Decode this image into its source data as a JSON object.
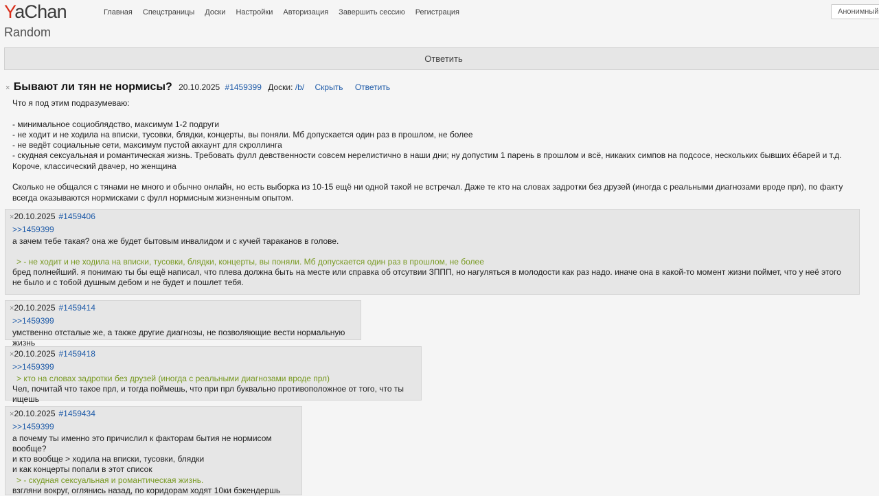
{
  "header": {
    "logo_y": "Y",
    "logo_rest": "aChan",
    "nav": [
      "Главная",
      "Спецстраницы",
      "Доски",
      "Настройки",
      "Авторизация",
      "Завершить сессию",
      "Регистрация"
    ],
    "user_label": "Анонимный"
  },
  "board": {
    "title": "Random",
    "reply_label": "Ответить"
  },
  "op": {
    "close": "×",
    "title": "Бывают ли тян не нормисы?",
    "date": "20.10.2025",
    "number": "#1459399",
    "boards_label": "Доски:",
    "board_link": "/b/",
    "hide_label": "Скрыть",
    "reply_label": "Ответить",
    "body": [
      "Что я под этим подразумеваю:",
      "",
      "- минимальное социоблядство, максимум 1-2 подруги",
      "- не ходит и не ходила на вписки, тусовки, блядки, концерты, вы поняли. Мб допускается один раз в прошлом, не более",
      "- не ведёт социальные сети, максимум пустой аккаунт для скроллинга",
      "- скудная сексуальная и романтическая жизнь. Требовать фулл девственности совсем нерелистично в наши дни; ну допустим 1 парень в прошлом и всё, никаких симпов на подсосе, нескольких бывших ёбарей и т.д.",
      "Короче, классический двачер, но женщина",
      "",
      "Сколько не общался с тянами не много и обычно онлайн, но есть выборка из 10-15 ещё ни одной такой не встречал. Даже те кто на словах задротки без друзей (иногда с реальными диагнозами вроде прл), по факту всегда оказываются нормисками с фулл нормисным жизненным опытом."
    ]
  },
  "replies": [
    {
      "date": "20.10.2025",
      "number": "#1459406",
      "reflink": ">>1459399",
      "lines": [
        {
          "t": "text",
          "v": "а зачем тебе такая? она же будет бытовым инвалидом и с кучей тараканов в голове."
        },
        {
          "t": "gap"
        },
        {
          "t": "quote",
          "v": "> - не ходит и не ходила на вписки, тусовки, блядки, концерты, вы поняли. Мб допускается один раз в прошлом, не более"
        },
        {
          "t": "text",
          "v": "бред полнейший. я понимаю ты бы ещё написал, что плева должна быть на месте или справка об отсутвии ЗППП, но нагуляться в молодости как раз надо. иначе она в какой-то момент жизни поймет, что у неё этого не было и с тобой душным дебом и не будет и пошлет тебя."
        }
      ]
    },
    {
      "date": "20.10.2025",
      "number": "#1459414",
      "reflink": ">>1459399",
      "lines": [
        {
          "t": "text",
          "v": "умственно отсталые же, а также другие диагнозы, не позволяющие вести нормальную жизнь"
        }
      ]
    },
    {
      "date": "20.10.2025",
      "number": "#1459418",
      "reflink": ">>1459399",
      "lines": [
        {
          "t": "quote",
          "v": "> кто на словах задротки без друзей (иногда с реальными диагнозами вроде прл)"
        },
        {
          "t": "text",
          "v": "Чел, почитай что такое прл, и тогда поймешь, что при прл буквально противоположное от того, что ты ищешь"
        }
      ]
    },
    {
      "date": "20.10.2025",
      "number": "#1459434",
      "reflink": ">>1459399",
      "lines": [
        {
          "t": "text",
          "v": "а почему ты именно это причислил к факторам бытия не нормисом вообще?"
        },
        {
          "t": "text",
          "v": "и кто вообще > ходила на вписки, тусовки, блядки"
        },
        {
          "t": "text",
          "v": "и как концерты попали в этот список"
        },
        {
          "t": "quote",
          "v": "> - скудная сексуальная и романтическая жизнь."
        },
        {
          "t": "text",
          "v": "взгляни вокруг, оглянись назад, по коридорам ходят 10ки бэкендершь"
        }
      ]
    }
  ],
  "colors": {
    "link": "#1d5aa8",
    "quote": "#789922",
    "logo_y": "#d92e1a",
    "post_bg": "#e6e6e6"
  }
}
